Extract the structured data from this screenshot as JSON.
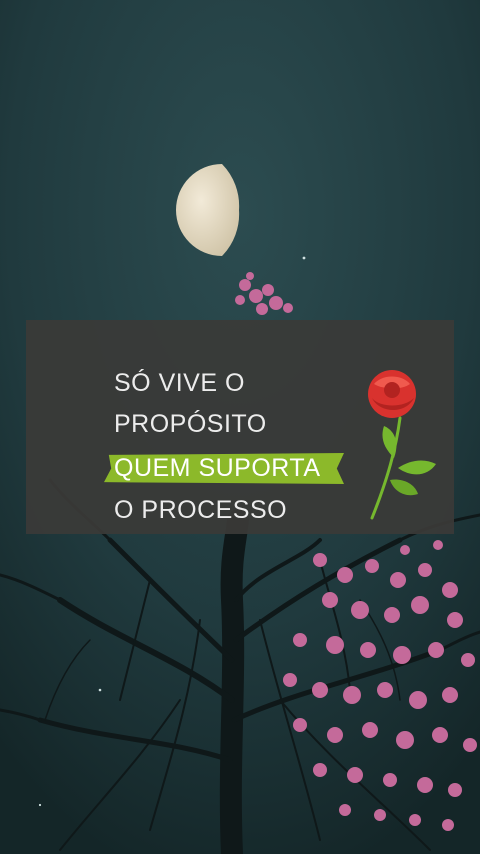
{
  "quote": {
    "line1": "SÓ VIVE O",
    "line2": "PROPÓSITO",
    "line3": "QUEM SUPORTA",
    "line4": "O PROCESSO"
  },
  "colors": {
    "sky": "#1f3a3d",
    "card": "#3a3a38",
    "highlight": "#8cb92a",
    "blossom": "#c46a9a",
    "rose": "#d9322e",
    "leaf": "#76b82e"
  },
  "icons": {
    "decoration": "rose-icon"
  }
}
